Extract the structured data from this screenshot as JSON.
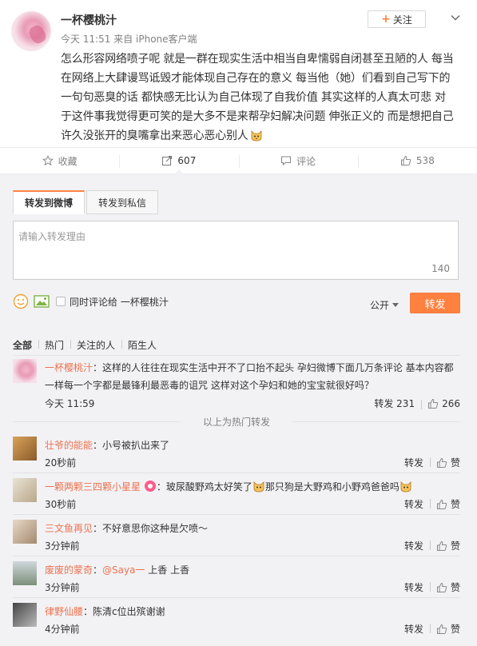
{
  "post": {
    "author": "一杯樱桃汁",
    "meta": "今天 11:51 来自 iPhone客户端",
    "follow_label": "关注",
    "follow_plus": "+",
    "lines": [
      "怎么形容网络喷子呢 就是一群在现实生活中相当自卑懦弱自闭甚至丑陋的人 每当",
      "在网络上大肆谩骂诋毁才能体现自己存在的意义 每当他（她）们看到自己写下的",
      "一句句恶臭的话 都快感无比认为自己体现了自我价值 其实这样的人真太可悲 对",
      "于这件事我觉得更可笑的是大多不是来帮孕妇解决问题 伸张正义的 而是想把自己",
      "许久没张开的臭嘴拿出来恶心恶心别人"
    ]
  },
  "actions": {
    "favorite": "收藏",
    "repost_count": "607",
    "comment": "评论",
    "like_count": "538"
  },
  "repost_form": {
    "tab_repost_weibo": "转发到微博",
    "tab_repost_private": "转发到私信",
    "placeholder": "请输入转发理由",
    "char_count": "140",
    "also_comment_label": "同时评论给 一杯樱桃汁",
    "visibility": "公开",
    "submit_label": "转发"
  },
  "filter": {
    "items": [
      "全部",
      "热门",
      "关注的人",
      "陌生人"
    ]
  },
  "hot_repost": {
    "name": "一杯樱桃汁",
    "text": "：这样的人往往在现实生活中开不了口抬不起头 孕妇微博下面几万条评论 基本内容都",
    "text2": "一样每一个字都是最锋利最恶毒的诅咒 这样对这个孕妇和她的宝宝就很好吗？",
    "time": "今天 11:59",
    "repost_label": "转发 231",
    "like_count": "266"
  },
  "hot_divider": "以上为热门转发",
  "reposts": [
    {
      "name": "壮爷的能能",
      "text": "：小号被扒出来了",
      "time": "20秒前",
      "repost_label": "转发",
      "like_label": "赞"
    },
    {
      "name": "一颗两颗三四颗小星星",
      "text_a": "：玻尿酸野鸡太好笑了",
      "text_b": "那只狗是大野鸡和小野鸡爸爸吗",
      "time": "30秒前",
      "repost_label": "转发",
      "like_label": "赞"
    },
    {
      "name": "三文鱼再见",
      "text": "：不好意思你这种是欠喷～",
      "time": "3分钟前",
      "repost_label": "转发",
      "like_label": "赞"
    },
    {
      "name": "废废的蒙奇",
      "text_pre": "：",
      "mention": "@Saya一",
      "text_post": " 上香 上香",
      "time": "3分钟前",
      "repost_label": "转发",
      "like_label": "赞"
    },
    {
      "name": "律野仙腰",
      "text": "：陈清c位出殡谢谢",
      "time": "4分钟前",
      "repost_label": "转发",
      "like_label": "赞"
    }
  ],
  "colors": {
    "accent": "#ff8140",
    "name_link": "#eb7350",
    "panel_bg": "#f2f2f5"
  }
}
